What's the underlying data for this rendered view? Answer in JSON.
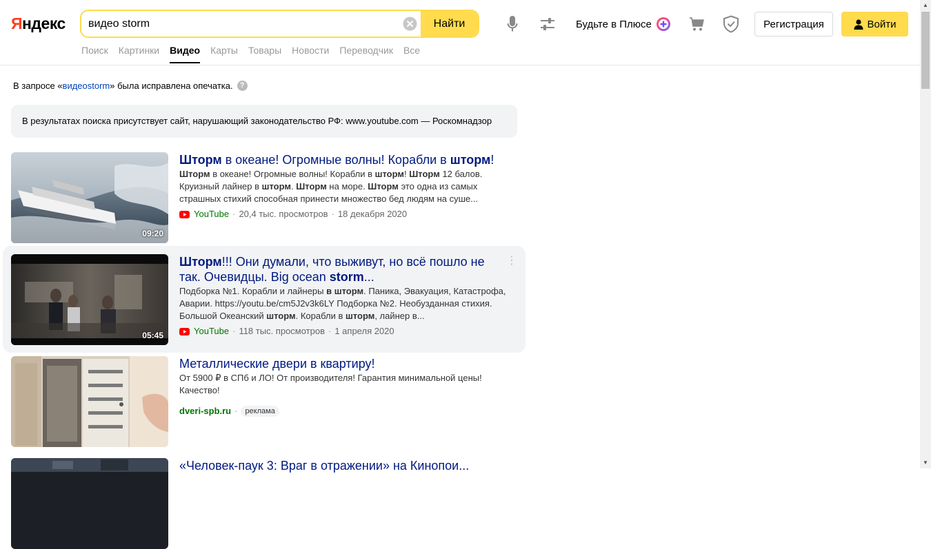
{
  "colors": {
    "logo_red": "#fc3f1d",
    "accent_yellow": "#ffdb4d",
    "link_blue": "#04b",
    "title_blue": "#001a80",
    "source_green": "#007700"
  },
  "header": {
    "logo_first": "Я",
    "logo_rest": "ндекс",
    "search_value": "видео storm",
    "find_label": "Найти",
    "plus_label": "Будьте в Плюсе",
    "register_label": "Регистрация",
    "login_label": "Войти",
    "icons": [
      "clear-icon",
      "microphone-icon",
      "filter-sliders-icon",
      "plus-badge-icon",
      "cart-icon",
      "shield-icon",
      "user-icon"
    ]
  },
  "tabs": [
    {
      "label": "Поиск",
      "active": false
    },
    {
      "label": "Картинки",
      "active": false
    },
    {
      "label": "Видео",
      "active": true
    },
    {
      "label": "Карты",
      "active": false
    },
    {
      "label": "Товары",
      "active": false
    },
    {
      "label": "Новости",
      "active": false
    },
    {
      "label": "Переводчик",
      "active": false
    },
    {
      "label": "Все",
      "active": false
    }
  ],
  "typo_notice": {
    "before": "В запросе «",
    "link": "видеоstorm",
    "after": "» была исправлена опечатка.",
    "help": "?"
  },
  "rkn_notice": "В результатах поиска присутствует сайт, нарушающий законодательство РФ: www.youtube.com — Роскомнадзор",
  "results": [
    {
      "kind": "video",
      "title_lines": [
        [
          {
            "t": "Шторм",
            "b": true
          },
          {
            "t": " в океане! Огромные волны! Корабли в ",
            "b": false
          },
          {
            "t": "шторм",
            "b": true
          },
          {
            "t": "!",
            "b": false
          }
        ]
      ],
      "snippet_lines": [
        [
          {
            "t": "Шторм",
            "b": true
          },
          {
            "t": " в океане! Огромные волны! Корабли в ",
            "b": false
          },
          {
            "t": "шторм",
            "b": true
          },
          {
            "t": "! ",
            "b": false
          },
          {
            "t": "Шторм",
            "b": true
          },
          {
            "t": " 12 балов.",
            "b": false
          }
        ],
        [
          {
            "t": "Круизный лайнер в ",
            "b": false
          },
          {
            "t": "шторм",
            "b": true
          },
          {
            "t": ". ",
            "b": false
          },
          {
            "t": "Шторм",
            "b": true
          },
          {
            "t": " на море. ",
            "b": false
          },
          {
            "t": "Шторм",
            "b": true
          },
          {
            "t": " это одна из самых",
            "b": false
          }
        ],
        [
          {
            "t": "страшных стихий способная принести множество бед людям на суше...",
            "b": false
          }
        ]
      ],
      "source": "YouTube",
      "views": "20,4 тыс. просмотров",
      "date": "18 декабря 2020",
      "duration": "09:20",
      "thumb": "ship-in-storm"
    },
    {
      "kind": "video",
      "title_lines": [
        [
          {
            "t": "Шторм",
            "b": true
          },
          {
            "t": "!!! Они думали, что выживут, но всё пошло не",
            "b": false
          }
        ],
        [
          {
            "t": "так. Очевидцы. Big ocean ",
            "b": false
          },
          {
            "t": "storm",
            "b": true
          },
          {
            "t": "...",
            "b": false
          }
        ]
      ],
      "snippet_lines": [
        [
          {
            "t": "Подборка №1. Корабли и лайнеры ",
            "b": false
          },
          {
            "t": "в шторм",
            "b": true
          },
          {
            "t": ". Паника, Эвакуация, Катастрофа,",
            "b": false
          }
        ],
        [
          {
            "t": "Аварии. https://youtu.be/cm5J2v3k6LY Подборка №2. Необузданная стихия.",
            "b": false
          }
        ],
        [
          {
            "t": "Большой Океанский ",
            "b": false
          },
          {
            "t": "шторм",
            "b": true
          },
          {
            "t": ". Корабли в ",
            "b": false
          },
          {
            "t": "шторм",
            "b": true
          },
          {
            "t": ", лайнер в...",
            "b": false
          }
        ]
      ],
      "source": "YouTube",
      "views": "118 тыс. просмотров",
      "date": "1 апреля 2020",
      "duration": "05:45",
      "thumb": "ship-interior"
    },
    {
      "kind": "ad",
      "title_lines": [
        [
          {
            "t": "Металлические двери в квартиру!",
            "b": false
          }
        ]
      ],
      "snippet_lines": [
        [
          {
            "t": "От 5900 ₽ в СПб и ЛО! От производителя! Гарантия минимальной цены!",
            "b": false
          }
        ],
        [
          {
            "t": "Качество!",
            "b": false
          }
        ]
      ],
      "domain": "dveri-spb.ru",
      "ad_label": "реклама",
      "thumb": "doors"
    },
    {
      "kind": "video",
      "title_lines": [
        [
          {
            "t": "«Человек-паук 3: Враг в отражении» на Кинопои...",
            "b": false
          }
        ]
      ],
      "snippet_lines": [],
      "thumb": "dark-film"
    }
  ]
}
